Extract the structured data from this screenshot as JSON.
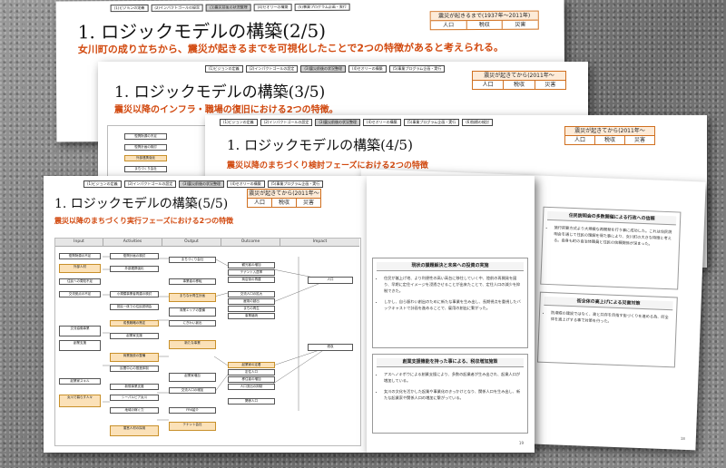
{
  "nav_items": [
    "(1)ビジョンの定義",
    "(2)インパクトゴールの設定",
    "(3)震災前後の状況整理",
    "(4)セオリーの構築",
    "(5)事業プログラム企画・実行",
    "(6)指標の検討"
  ],
  "tag": {
    "header_pre": "震災が起きるまで(1937年〜2011年)",
    "header_post": "震災が起きてから(2011年〜",
    "cols": [
      "人口",
      "税収",
      "災害"
    ]
  },
  "slide1": {
    "title": "1. ロジックモデルの構築(2/5)",
    "subtitle": "女川町の成り立ちから、震災が起きるまでを可視化したことで2つの特徴があると考えられる。"
  },
  "slide2": {
    "title": "1. ロジックモデルの構築(3/5)",
    "subtitle": "震災以降のインフラ・職場の復旧における2つの特徴。"
  },
  "slide3": {
    "title": "1. ロジックモデルの構築(4/5)",
    "subtitle": "震災以降のまちづくり検討フェーズにおける2つの特徴",
    "page": "18"
  },
  "slide5": {
    "panel1_title": "住民説明会の多数開催による行政への信頼",
    "panel1_text": "施行前要方式より大規模な再開発を行う事に成功した。これは住民説明会を通じて住民の理解を得た事により、女川町の大きな特徴と考える。自身も町の自治体職員と住民の信頼関係が深まった。",
    "panel2_title": "街全体の高上げによる災害対策",
    "panel2_text": "防潮堤の建設ではなく、高と共存を目指す街づくりを進める為、町全体を嵩上げする事で対策を行った。"
  },
  "slide4": {
    "title": "1. ロジックモデルの構築(5/5)",
    "subtitle": "震災以降のまちづくり実行フェーズにおける2つの特徴",
    "page": "19",
    "flow_cols": [
      "Input",
      "Activities",
      "Output",
      "Outcome",
      "Impact"
    ],
    "input_boxes": [
      "復興財源の不足",
      "外部人材",
      "住民への周知不足",
      "交流拠点の不足",
      "交流協働事業",
      "創業支援",
      "起業家スキル",
      "女川で暮らす人々"
    ],
    "activity_boxes": [
      "復興計画の検討",
      "外部連携強化",
      "小規模事業者再建の検討",
      "官民一体での住民説明会",
      "成長戦略の策定",
      "起業家支援",
      "商業施設の整備",
      "民間中心の推進体制",
      "新規事業支援",
      "シーパルピア女川",
      "地域の稼ぐ力",
      "運営人材の採用"
    ],
    "output_boxes": [
      "まちづくり会社",
      "事業者の移転",
      "まちなか再生計画",
      "商業エリアの整備",
      "にぎわい創出",
      "新たな事業",
      "起業家増加",
      "交流人口の増加",
      "FRK紹介",
      "テナント会社"
    ],
    "outcome_boxes": [
      "観光客の増加",
      "テナント入居率",
      "商店街の再建",
      "交流人口の拡大",
      "雇用の創出",
      "まちの再生",
      "事業継続",
      "起業家の定着",
      "定住人口",
      "移住者の増加",
      "人口流出の抑制",
      "関係人口"
    ],
    "impact_boxes": [
      "人口",
      "税収"
    ],
    "panel1_title": "現状の課題解決と未来への投資の実施",
    "panel1_items": [
      "住民が嵩上げ地、より利便性の高い高台に移住していく中、陸前の再開発を図り、早期に定住イメージを浸透させることが出来たことで、定住人口の減少を抑制できた。",
      "しかし、自ら賑わい創出のために新たな事業を生み出し、長期視点を重視したバックキャストで計画を進めることで、雇用の創出に繋がった。"
    ],
    "panel2_title": "創業支援機能を持った事による、税収増加施策",
    "panel2_items": [
      "アスヘノキボウによる創業支援により、多数の起業者が生み出され、起業人口が増加している。",
      "女川の文化を活かした起業や事業化のきっかけとなり、関係人口を生み出し、新たな起業家や関係人口の増加に繋がっている。"
    ]
  }
}
